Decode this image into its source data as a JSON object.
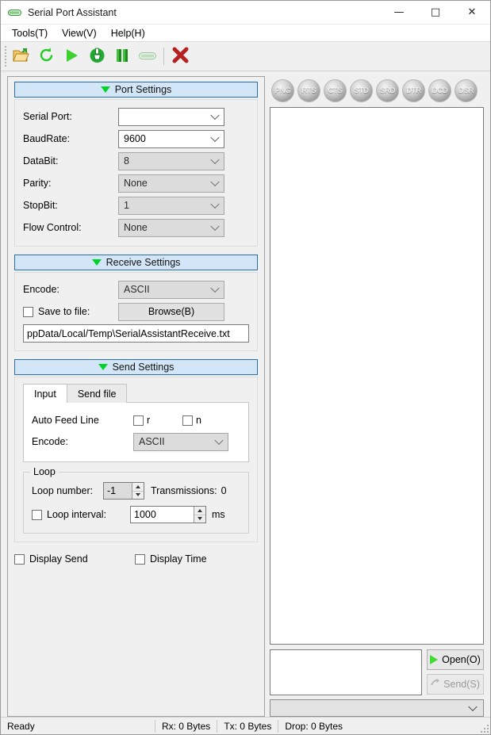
{
  "window": {
    "title": "Serial Port Assistant",
    "icon": "serial-port-icon",
    "minimize": "—",
    "maximize": "□",
    "close": "✕"
  },
  "menubar": {
    "items": [
      {
        "label": "Tools(T)",
        "name": "menu-tools"
      },
      {
        "label": "View(V)",
        "name": "menu-view"
      },
      {
        "label": "Help(H)",
        "name": "menu-help"
      }
    ]
  },
  "toolbar": {
    "buttons": [
      {
        "icon": "open-folder-icon",
        "name": "toolbar-open-file"
      },
      {
        "icon": "refresh-icon",
        "name": "toolbar-refresh-ports"
      },
      {
        "icon": "play-icon",
        "name": "toolbar-start"
      },
      {
        "icon": "clear-broom-icon",
        "name": "toolbar-clear"
      },
      {
        "icon": "pause-icon",
        "name": "toolbar-pause"
      },
      {
        "icon": "serial-device-icon",
        "name": "toolbar-device"
      },
      {
        "icon": "close-x-icon",
        "name": "toolbar-close"
      }
    ]
  },
  "port_settings": {
    "header": "Port Settings",
    "collapse_icon": "triangle-down-icon",
    "fields": [
      {
        "label": "Serial Port:",
        "value": "",
        "disabled": false,
        "name": "serial-port"
      },
      {
        "label": "BaudRate:",
        "value": "9600",
        "disabled": false,
        "name": "baudrate"
      },
      {
        "label": "DataBit:",
        "value": "8",
        "disabled": true,
        "name": "databit"
      },
      {
        "label": "Parity:",
        "value": "None",
        "disabled": true,
        "name": "parity"
      },
      {
        "label": "StopBit:",
        "value": "1",
        "disabled": true,
        "name": "stopbit"
      },
      {
        "label": "Flow Control:",
        "value": "None",
        "disabled": true,
        "name": "flow-control"
      }
    ]
  },
  "receive_settings": {
    "header": "Receive Settings",
    "collapse_icon": "triangle-down-icon",
    "encode_label": "Encode:",
    "encode_value": "ASCII",
    "save_to_file_label": "Save to file:",
    "save_to_file_checked": false,
    "browse_label": "Browse(B)",
    "file_path": "ppData/Local/Temp\\SerialAssistantReceive.txt"
  },
  "send_settings": {
    "header": "Send Settings",
    "collapse_icon": "triangle-down-icon",
    "tabs": [
      {
        "label": "Input",
        "active": true,
        "name": "tab-input"
      },
      {
        "label": "Send file",
        "active": false,
        "name": "tab-send-file"
      }
    ],
    "auto_feed_line_label": "Auto Feed Line",
    "auto_feed_r": "r",
    "auto_feed_n": "n",
    "auto_feed_r_checked": false,
    "auto_feed_n_checked": false,
    "encode_label": "Encode:",
    "encode_value": "ASCII",
    "loop": {
      "legend": "Loop",
      "loop_number_label": "Loop number:",
      "loop_number_value": "-1",
      "transmissions_label": "Transmissions:",
      "transmissions_value": "0",
      "loop_interval_label": "Loop interval:",
      "loop_interval_checked": false,
      "loop_interval_value": "1000",
      "loop_interval_unit": "ms"
    }
  },
  "display_options": {
    "display_send_label": "Display Send",
    "display_send_checked": false,
    "display_time_label": "Display Time",
    "display_time_checked": false
  },
  "signals": {
    "leds": [
      {
        "label": "PNG",
        "name": "led-png"
      },
      {
        "label": "RTS",
        "name": "led-rts"
      },
      {
        "label": "CTS",
        "name": "led-cts"
      },
      {
        "label": "STD",
        "name": "led-std"
      },
      {
        "label": "SRD",
        "name": "led-srd"
      },
      {
        "label": "DTR",
        "name": "led-dtr"
      },
      {
        "label": "DCD",
        "name": "led-dcd"
      },
      {
        "label": "DSR",
        "name": "led-dsr"
      }
    ]
  },
  "receive_area": {
    "content": ""
  },
  "send_area": {
    "content": "",
    "open_label": "Open(O)",
    "send_label": "Send(S)",
    "send_disabled": true,
    "history_value": ""
  },
  "statusbar": {
    "ready": "Ready",
    "rx": "Rx: 0 Bytes",
    "tx": "Tx: 0 Bytes",
    "drop": "Drop: 0 Bytes"
  },
  "colors": {
    "accent_green": "#00d428",
    "section_header_bg": "#d3e6f7",
    "section_header_border": "#2a6ea8",
    "window_bg": "#f0f0f0",
    "close_red": "#b52020"
  }
}
